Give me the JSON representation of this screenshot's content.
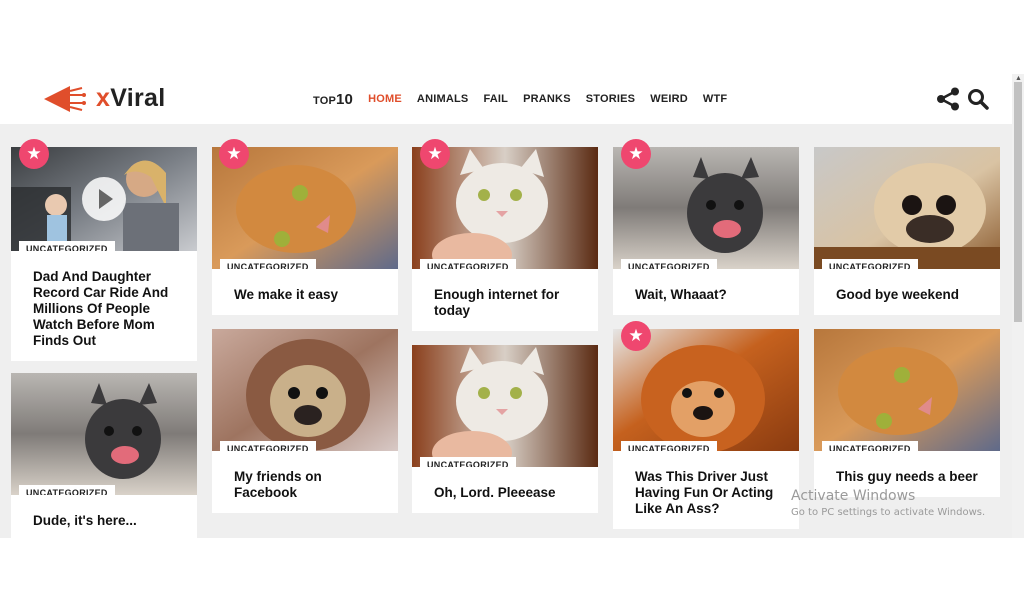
{
  "brand": {
    "name_x": "x",
    "name_rest": "Viral",
    "color": "#e04e2b"
  },
  "nav": {
    "top_prefix": "TOP",
    "top_num": "10",
    "items": [
      "HOME",
      "ANIMALS",
      "FAIL",
      "PRANKS",
      "STORIES",
      "WEIRD",
      "WTF"
    ],
    "active": "HOME"
  },
  "icons": {
    "share": "share-icon",
    "search": "search-icon",
    "star": "star-icon",
    "play": "play-icon",
    "logo": "megaphone-icon"
  },
  "cards": [
    {
      "category": "UNCATEGORIZED",
      "title": "Dad And Daughter Record Car Ride And Millions Of People Watch Before Mom Finds Out"
    },
    {
      "category": "UNCATEGORIZED",
      "title": "Dude, it's here..."
    },
    {
      "category": "UNCATEGORIZED",
      "title": "We make it easy"
    },
    {
      "category": "UNCATEGORIZED",
      "title": "My friends on Facebook"
    },
    {
      "category": "UNCATEGORIZED",
      "title": "Enough internet for today"
    },
    {
      "category": "UNCATEGORIZED",
      "title": "Oh, Lord. Pleeease"
    },
    {
      "category": "UNCATEGORIZED",
      "title": "Wait, Whaaat?"
    },
    {
      "category": "UNCATEGORIZED",
      "title": "Was This Driver Just Having Fun Or Acting Like An Ass?"
    },
    {
      "category": "UNCATEGORIZED",
      "title": "Good bye weekend"
    },
    {
      "category": "UNCATEGORIZED",
      "title": "This guy needs a beer"
    }
  ],
  "watermark": {
    "line1": "Activate Windows",
    "line2": "Go to PC settings to activate Windows."
  },
  "colors": {
    "star": "#ef476f",
    "background": "#efefef"
  }
}
